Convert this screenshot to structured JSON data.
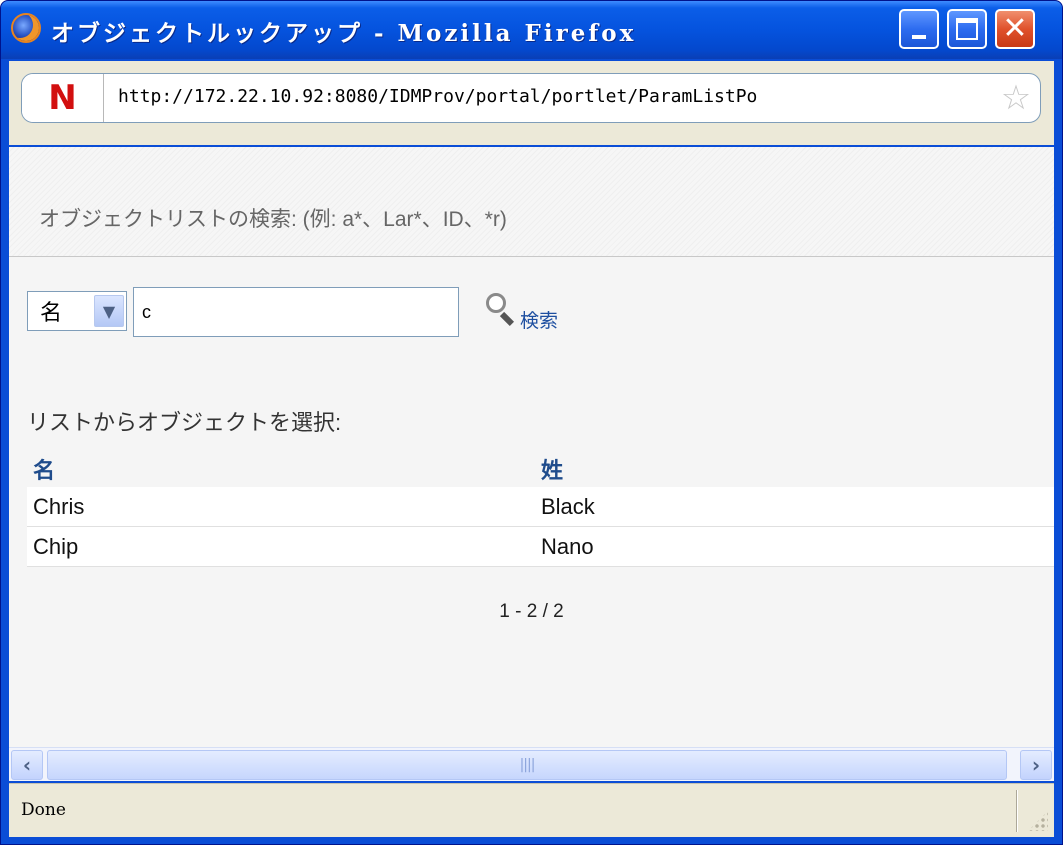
{
  "window": {
    "title": "オブジェクトルックアップ - Mozilla Firefox"
  },
  "address_bar": {
    "url": "http://172.22.10.92:8080/IDMProv/portal/portlet/ParamListPo",
    "site_icon": "novell-n-icon"
  },
  "header": {
    "search_hint": "オブジェクトリストの検索: (例: a*、Lar*、ID、*r)"
  },
  "search": {
    "field_options": [
      "名"
    ],
    "selected_field": "名",
    "query": "c",
    "button_label": "検索"
  },
  "results": {
    "heading": "リストからオブジェクトを選択:",
    "columns": [
      "名",
      "姓"
    ],
    "rows": [
      {
        "first": "Chris",
        "last": "Black"
      },
      {
        "first": "Chip",
        "last": "Nano"
      }
    ],
    "pager": "1 - 2 / 2"
  },
  "status": {
    "text": "Done"
  },
  "colors": {
    "titlebar": "#0553de",
    "link": "#1e4fa0",
    "column_header": "#1f4c8c",
    "close_button": "#e0522c"
  }
}
